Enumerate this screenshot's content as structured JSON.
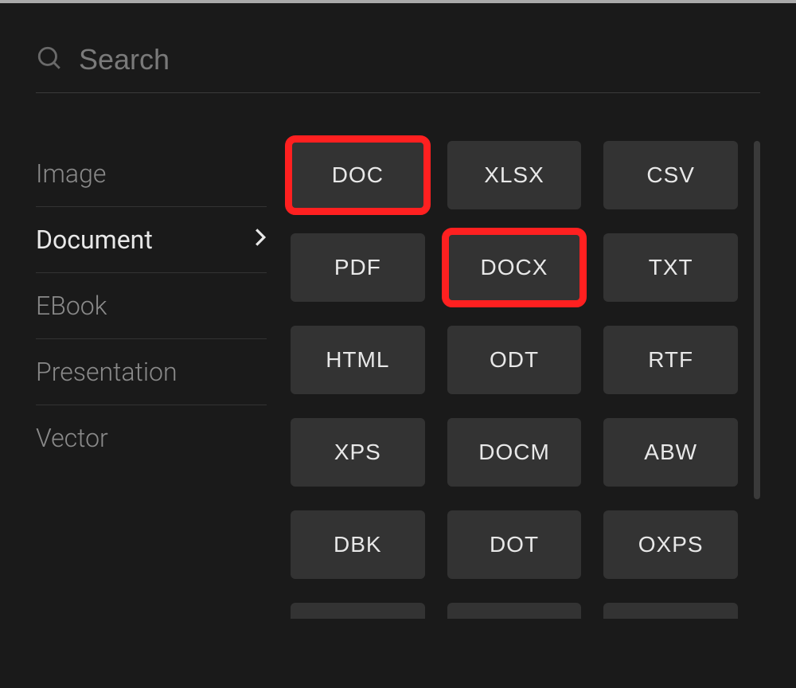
{
  "search": {
    "placeholder": "Search"
  },
  "sidebar": {
    "items": [
      {
        "label": "Image",
        "active": false
      },
      {
        "label": "Document",
        "active": true
      },
      {
        "label": "EBook",
        "active": false
      },
      {
        "label": "Presentation",
        "active": false
      },
      {
        "label": "Vector",
        "active": false
      }
    ]
  },
  "formats": [
    {
      "label": "DOC",
      "highlighted": true
    },
    {
      "label": "XLSX",
      "highlighted": false
    },
    {
      "label": "CSV",
      "highlighted": false
    },
    {
      "label": "PDF",
      "highlighted": false
    },
    {
      "label": "DOCX",
      "highlighted": true
    },
    {
      "label": "TXT",
      "highlighted": false
    },
    {
      "label": "HTML",
      "highlighted": false
    },
    {
      "label": "ODT",
      "highlighted": false
    },
    {
      "label": "RTF",
      "highlighted": false
    },
    {
      "label": "XPS",
      "highlighted": false
    },
    {
      "label": "DOCM",
      "highlighted": false
    },
    {
      "label": "ABW",
      "highlighted": false
    },
    {
      "label": "DBK",
      "highlighted": false
    },
    {
      "label": "DOT",
      "highlighted": false
    },
    {
      "label": "OXPS",
      "highlighted": false
    }
  ]
}
